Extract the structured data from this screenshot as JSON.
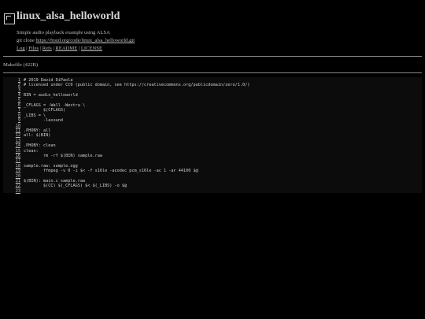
{
  "repo": {
    "title": "linux_alsa_helloworld",
    "description": "Simple audio playback example using ALSA",
    "clone_prefix": "git clone ",
    "clone_url": "https://fnstd.org/code/linux_alsa_helloworld.git"
  },
  "nav": {
    "log": "Log",
    "files": "Files",
    "refs": "Refs",
    "readme": "README",
    "license": "LICENSE",
    "separator": " | "
  },
  "file": {
    "info": "Makefile (422B)"
  },
  "code": {
    "lines": [
      {
        "n": "1",
        "text": "# 2019 David DiPaola"
      },
      {
        "n": "2",
        "text": "# licensed under CC0 (public domain, see https://creativecommons.org/publicdomain/zero/1.0/)"
      },
      {
        "n": "3",
        "text": ""
      },
      {
        "n": "4",
        "text": "BIN = audio_helloworld"
      },
      {
        "n": "5",
        "text": ""
      },
      {
        "n": "6",
        "text": "_CFLAGS = -Wall -Wextra \\"
      },
      {
        "n": "7",
        "text": "\t$(CFLAGS)"
      },
      {
        "n": "8",
        "text": "_LIBS = \\"
      },
      {
        "n": "9",
        "text": "\t-lasound"
      },
      {
        "n": "10",
        "text": ""
      },
      {
        "n": "11",
        "text": ".PHONY: all"
      },
      {
        "n": "12",
        "text": "all: $(BIN)"
      },
      {
        "n": "13",
        "text": ""
      },
      {
        "n": "14",
        "text": ".PHONY: clean"
      },
      {
        "n": "15",
        "text": "clean:"
      },
      {
        "n": "16",
        "text": "\trm -rf $(BIN) sample.raw"
      },
      {
        "n": "17",
        "text": ""
      },
      {
        "n": "18",
        "text": "sample.raw: sample.ogg"
      },
      {
        "n": "19",
        "text": "\tffmpeg -v 0 -i $< -f s16le -acodec pcm_s16le -ac 1 -ar 44100 $@"
      },
      {
        "n": "20",
        "text": ""
      },
      {
        "n": "21",
        "text": "$(BIN): main.c sample.raw"
      },
      {
        "n": "22",
        "text": "\t$(CC) $(_CFLAGS) $< $(_LIBS) -o $@"
      },
      {
        "n": "23",
        "text": ""
      }
    ]
  }
}
